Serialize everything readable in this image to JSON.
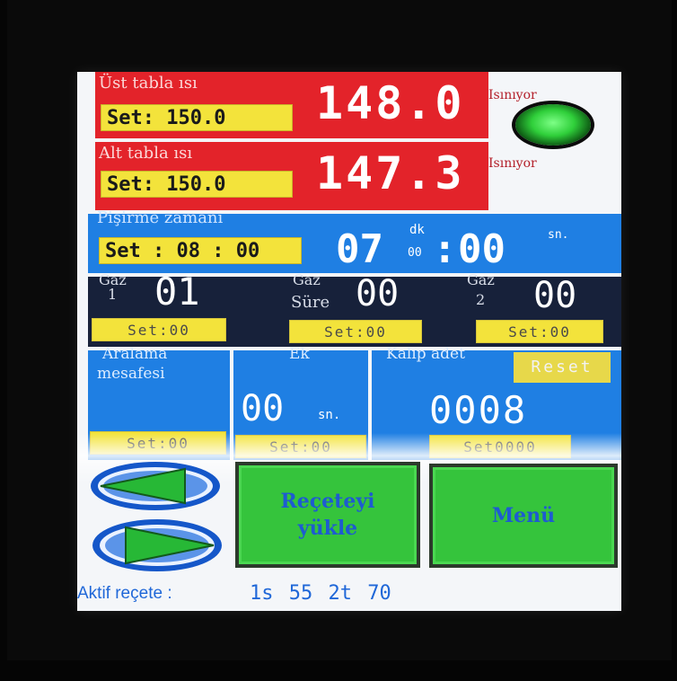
{
  "top_heater": {
    "label": "Üst tabla ısı",
    "set_label": "Set: 150.0",
    "value": "148.0",
    "status": "Isınıyor"
  },
  "bottom_heater": {
    "label": "Alt tabla ısı",
    "set_label": "Set: 150.0",
    "value": "147.3",
    "status": "Isınıyor"
  },
  "pressing_time": {
    "label": "Pişirme zamanı",
    "set_label": "Set : 08 : 00",
    "minutes": "07",
    "min_unit": "dk",
    "small_digits": "00",
    "colon": ":",
    "seconds": "00",
    "sec_unit": "sn."
  },
  "gas1": {
    "label_top": "Gaz",
    "label_bottom": "1",
    "value": "01",
    "set_label": "Set:00"
  },
  "gas_time": {
    "label_top": "Gaz",
    "label_bottom": "Süre",
    "value": "00",
    "set_label": "Set:00"
  },
  "gas2": {
    "label_top": "Gaz",
    "label_bottom": "2",
    "value": "00",
    "set_label": "Set:00"
  },
  "opening_distance": {
    "label_line1": "Aralama",
    "label_line2": "mesafesi",
    "set_label": "Set:00"
  },
  "ek": {
    "label": "Ek",
    "value": "00",
    "unit": "sn.",
    "set_label": "Set:00"
  },
  "mold_count": {
    "label": "Kalıp adet",
    "value": "0008",
    "set_label": "Set0000",
    "reset_label": "Reset"
  },
  "buttons": {
    "load_recipe_line1": "Reçeteyi",
    "load_recipe_line2": "yükle",
    "menu": "Menü"
  },
  "status_bar": {
    "active_recipe_label": "Aktif reçete :",
    "active_recipe_value": "1s 55 2t 70"
  },
  "colors": {
    "red_panel": "#e3232a",
    "blue_panel": "#1f7fe3",
    "navy_panel": "#17213a",
    "set_yellow": "#f3e33b",
    "button_green": "#35c43c",
    "button_text_blue": "#1e5bd1",
    "led_green": "#3ee04a"
  }
}
